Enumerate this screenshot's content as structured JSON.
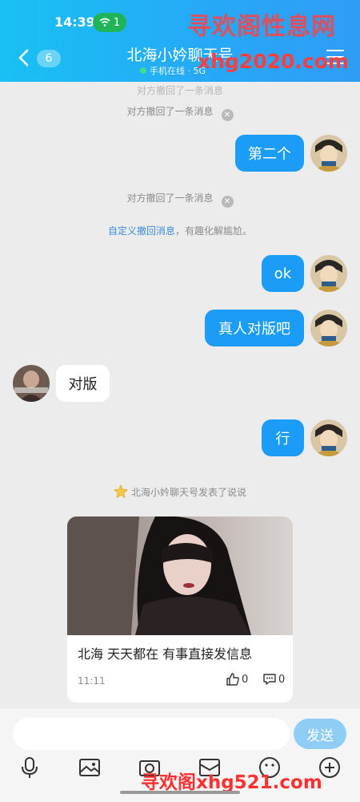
{
  "status": {
    "time": "14:39",
    "wifi_count": "1"
  },
  "header": {
    "unread_count": "6",
    "title": "北海小妗聊天号",
    "subtitle": "手机在线 · 5G",
    "watermark_top": "寻欢阁性息网",
    "watermark_url": "xhg2020.com"
  },
  "messages": {
    "recall_partial": "对方撤回了一条消息",
    "recall_1": "对方撤回了一条消息",
    "recall_2": "对方撤回了一条消息",
    "hint_link": "自定义撤回消息",
    "hint_text": "，有趣化解尴尬。",
    "bubble_1": "第二个",
    "bubble_2": "ok",
    "bubble_3": "真人对版吧",
    "bubble_4": "对版",
    "bubble_5": "行",
    "moment_note": "北海小妗聊天号发表了说说"
  },
  "card": {
    "text": "北海 天天都在 有事直接发信息",
    "time": "11:11",
    "likes": "0",
    "comments": "0"
  },
  "input": {
    "send_label": "发送",
    "placeholder": ""
  },
  "footer": {
    "watermark": "寻欢阁xhg521.com"
  },
  "icons": [
    "back-icon",
    "menu-icon",
    "close-icon",
    "star-icon",
    "like-icon",
    "comment-icon",
    "mic-icon",
    "image-icon",
    "camera-icon",
    "picture-icon",
    "emoji-icon",
    "plus-icon"
  ]
}
